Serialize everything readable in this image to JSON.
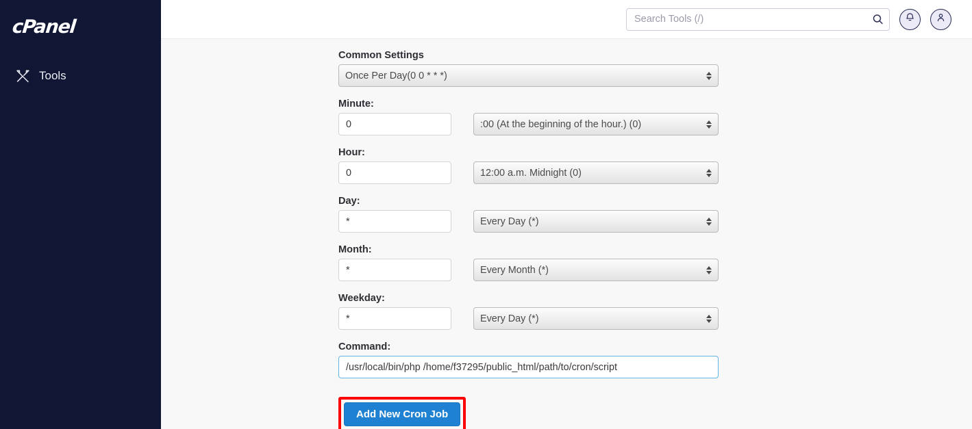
{
  "sidebar": {
    "brand": "cPanel",
    "brand_icon": "cpanel-logo",
    "items": [
      {
        "label": "Tools",
        "icon": "tools-icon"
      }
    ]
  },
  "header": {
    "search": {
      "placeholder": "Search Tools (/)",
      "value": "",
      "icon": "search-icon"
    },
    "notifications_icon": "bell-icon",
    "account_icon": "user-icon"
  },
  "form": {
    "common_settings": {
      "label": "Common Settings",
      "value": "Once Per Day(0 0 * * *)"
    },
    "fields": [
      {
        "label": "Minute:",
        "text_value": "0",
        "select_value": ":00 (At the beginning of the hour.) (0)"
      },
      {
        "label": "Hour:",
        "text_value": "0",
        "select_value": "12:00 a.m. Midnight (0)"
      },
      {
        "label": "Day:",
        "text_value": "*",
        "select_value": "Every Day (*)"
      },
      {
        "label": "Month:",
        "text_value": "*",
        "select_value": "Every Month (*)"
      },
      {
        "label": "Weekday:",
        "text_value": "*",
        "select_value": "Every Day (*)"
      }
    ],
    "command": {
      "label": "Command:",
      "value": "/usr/local/bin/php /home/f37295/public_html/path/to/cron/script"
    },
    "submit_label": "Add New Cron Job"
  },
  "colors": {
    "sidebar_bg": "#111634",
    "button_blue": "#1e81d2",
    "highlight_red": "#fb0007",
    "focus_border": "#62b4e4",
    "content_bg": "#f8f8f9"
  }
}
